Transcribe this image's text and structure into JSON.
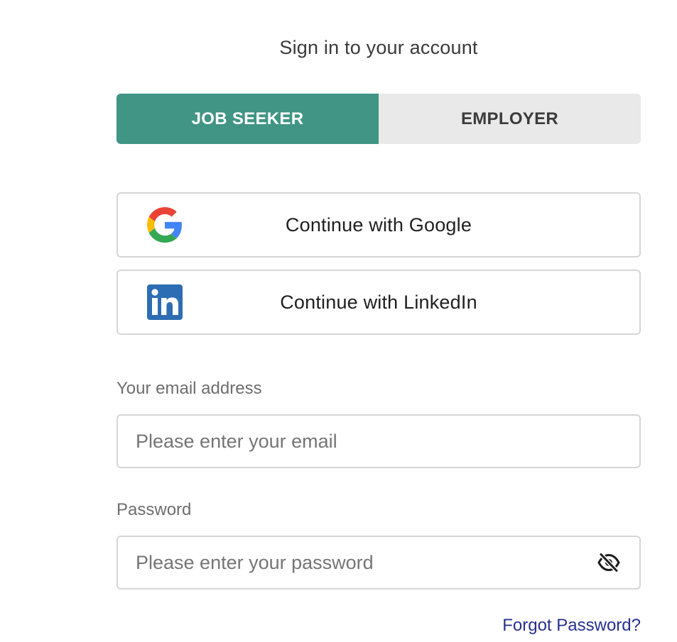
{
  "page": {
    "title": "Sign in to your account"
  },
  "role_toggle": {
    "tabs": [
      {
        "label": "JOB SEEKER",
        "active": true
      },
      {
        "label": "EMPLOYER",
        "active": false
      }
    ],
    "active_color": "#409585",
    "inactive_color": "#e9e9e9"
  },
  "social": {
    "google": {
      "label": "Continue with Google",
      "icon": "google-icon"
    },
    "linkedin": {
      "label": "Continue with LinkedIn",
      "icon": "linkedin-icon"
    }
  },
  "email": {
    "label": "Your email address",
    "placeholder": "Please enter your email",
    "value": ""
  },
  "password": {
    "label": "Password",
    "placeholder": "Please enter your password",
    "value": "",
    "toggle_icon": "eye-slash-icon"
  },
  "forgot": {
    "label": "Forgot Password?",
    "color": "#28308f"
  }
}
